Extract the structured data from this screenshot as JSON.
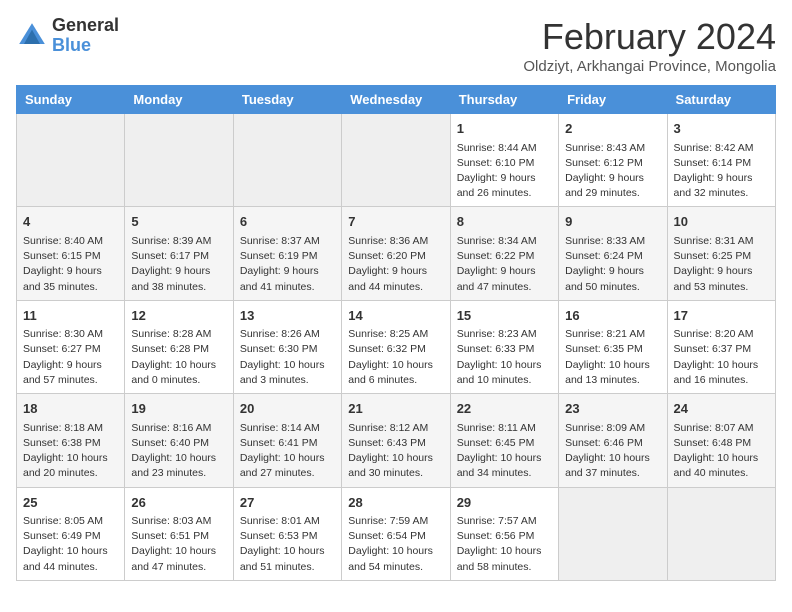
{
  "logo": {
    "general": "General",
    "blue": "Blue"
  },
  "title": "February 2024",
  "subtitle": "Oldziyt, Arkhangai Province, Mongolia",
  "days_of_week": [
    "Sunday",
    "Monday",
    "Tuesday",
    "Wednesday",
    "Thursday",
    "Friday",
    "Saturday"
  ],
  "weeks": [
    [
      {
        "day": "",
        "info": ""
      },
      {
        "day": "",
        "info": ""
      },
      {
        "day": "",
        "info": ""
      },
      {
        "day": "",
        "info": ""
      },
      {
        "day": "1",
        "info": "Sunrise: 8:44 AM\nSunset: 6:10 PM\nDaylight: 9 hours and 26 minutes."
      },
      {
        "day": "2",
        "info": "Sunrise: 8:43 AM\nSunset: 6:12 PM\nDaylight: 9 hours and 29 minutes."
      },
      {
        "day": "3",
        "info": "Sunrise: 8:42 AM\nSunset: 6:14 PM\nDaylight: 9 hours and 32 minutes."
      }
    ],
    [
      {
        "day": "4",
        "info": "Sunrise: 8:40 AM\nSunset: 6:15 PM\nDaylight: 9 hours and 35 minutes."
      },
      {
        "day": "5",
        "info": "Sunrise: 8:39 AM\nSunset: 6:17 PM\nDaylight: 9 hours and 38 minutes."
      },
      {
        "day": "6",
        "info": "Sunrise: 8:37 AM\nSunset: 6:19 PM\nDaylight: 9 hours and 41 minutes."
      },
      {
        "day": "7",
        "info": "Sunrise: 8:36 AM\nSunset: 6:20 PM\nDaylight: 9 hours and 44 minutes."
      },
      {
        "day": "8",
        "info": "Sunrise: 8:34 AM\nSunset: 6:22 PM\nDaylight: 9 hours and 47 minutes."
      },
      {
        "day": "9",
        "info": "Sunrise: 8:33 AM\nSunset: 6:24 PM\nDaylight: 9 hours and 50 minutes."
      },
      {
        "day": "10",
        "info": "Sunrise: 8:31 AM\nSunset: 6:25 PM\nDaylight: 9 hours and 53 minutes."
      }
    ],
    [
      {
        "day": "11",
        "info": "Sunrise: 8:30 AM\nSunset: 6:27 PM\nDaylight: 9 hours and 57 minutes."
      },
      {
        "day": "12",
        "info": "Sunrise: 8:28 AM\nSunset: 6:28 PM\nDaylight: 10 hours and 0 minutes."
      },
      {
        "day": "13",
        "info": "Sunrise: 8:26 AM\nSunset: 6:30 PM\nDaylight: 10 hours and 3 minutes."
      },
      {
        "day": "14",
        "info": "Sunrise: 8:25 AM\nSunset: 6:32 PM\nDaylight: 10 hours and 6 minutes."
      },
      {
        "day": "15",
        "info": "Sunrise: 8:23 AM\nSunset: 6:33 PM\nDaylight: 10 hours and 10 minutes."
      },
      {
        "day": "16",
        "info": "Sunrise: 8:21 AM\nSunset: 6:35 PM\nDaylight: 10 hours and 13 minutes."
      },
      {
        "day": "17",
        "info": "Sunrise: 8:20 AM\nSunset: 6:37 PM\nDaylight: 10 hours and 16 minutes."
      }
    ],
    [
      {
        "day": "18",
        "info": "Sunrise: 8:18 AM\nSunset: 6:38 PM\nDaylight: 10 hours and 20 minutes."
      },
      {
        "day": "19",
        "info": "Sunrise: 8:16 AM\nSunset: 6:40 PM\nDaylight: 10 hours and 23 minutes."
      },
      {
        "day": "20",
        "info": "Sunrise: 8:14 AM\nSunset: 6:41 PM\nDaylight: 10 hours and 27 minutes."
      },
      {
        "day": "21",
        "info": "Sunrise: 8:12 AM\nSunset: 6:43 PM\nDaylight: 10 hours and 30 minutes."
      },
      {
        "day": "22",
        "info": "Sunrise: 8:11 AM\nSunset: 6:45 PM\nDaylight: 10 hours and 34 minutes."
      },
      {
        "day": "23",
        "info": "Sunrise: 8:09 AM\nSunset: 6:46 PM\nDaylight: 10 hours and 37 minutes."
      },
      {
        "day": "24",
        "info": "Sunrise: 8:07 AM\nSunset: 6:48 PM\nDaylight: 10 hours and 40 minutes."
      }
    ],
    [
      {
        "day": "25",
        "info": "Sunrise: 8:05 AM\nSunset: 6:49 PM\nDaylight: 10 hours and 44 minutes."
      },
      {
        "day": "26",
        "info": "Sunrise: 8:03 AM\nSunset: 6:51 PM\nDaylight: 10 hours and 47 minutes."
      },
      {
        "day": "27",
        "info": "Sunrise: 8:01 AM\nSunset: 6:53 PM\nDaylight: 10 hours and 51 minutes."
      },
      {
        "day": "28",
        "info": "Sunrise: 7:59 AM\nSunset: 6:54 PM\nDaylight: 10 hours and 54 minutes."
      },
      {
        "day": "29",
        "info": "Sunrise: 7:57 AM\nSunset: 6:56 PM\nDaylight: 10 hours and 58 minutes."
      },
      {
        "day": "",
        "info": ""
      },
      {
        "day": "",
        "info": ""
      }
    ]
  ]
}
